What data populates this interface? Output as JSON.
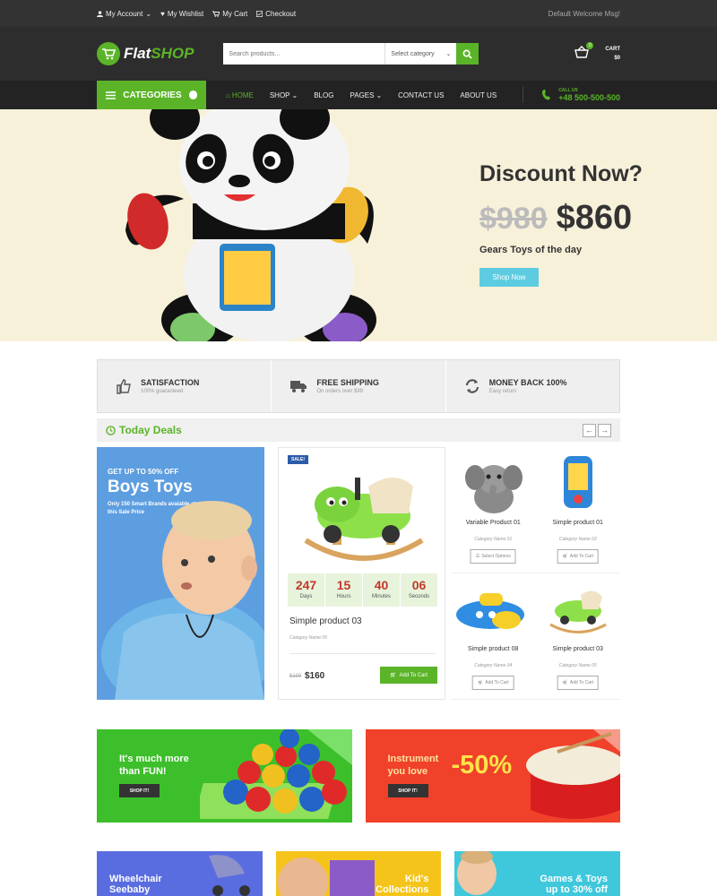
{
  "topbar": {
    "links": [
      {
        "label": "My Account",
        "icon": "user-icon",
        "dropdown": true
      },
      {
        "label": "My Wishlist",
        "icon": "heart-icon"
      },
      {
        "label": "My Cart",
        "icon": "cart-icon"
      },
      {
        "label": "Checkout",
        "icon": "checkout-icon"
      }
    ],
    "welcome": "Default Welcome Msg!"
  },
  "header": {
    "logo_a": "Flat",
    "logo_b": "SHOP",
    "search_placeholder": "Search products...",
    "category_select": "Select category",
    "cart_label": "CART",
    "cart_total": "$0",
    "cart_count": "0"
  },
  "nav": {
    "categories_label": "CATEGORIES",
    "items": [
      {
        "label": "HOME",
        "active": true
      },
      {
        "label": "SHOP",
        "dropdown": true
      },
      {
        "label": "BLOG"
      },
      {
        "label": "PAGES",
        "dropdown": true
      },
      {
        "label": "CONTACT US"
      },
      {
        "label": "ABOUT US"
      }
    ],
    "call_label": "CALL US",
    "call_number": "+48 500-500-500"
  },
  "hero": {
    "title": "Discount Now?",
    "old_price": "$980",
    "new_price": "$860",
    "subtitle": "Gears Toys of the day",
    "button": "Shop Now"
  },
  "features": [
    {
      "title": "SATISFACTION",
      "sub": "100% guaranteed",
      "icon": "thumbs-up-icon"
    },
    {
      "title": "FREE SHIPPING",
      "sub": "On orders over $99",
      "icon": "truck-icon"
    },
    {
      "title": "MONEY BACK 100%",
      "sub": "Easy return",
      "icon": "refresh-icon"
    }
  ],
  "deals": {
    "title": "Today Deals",
    "promo": {
      "line1": "GET UP TO 50% OFF",
      "line2": "Boys Toys",
      "line3": "Only 150 Smart Brands avaiable at this Sale Price"
    },
    "featured": {
      "badge": "SALE!",
      "countdown": [
        {
          "num": "247",
          "unit": "Days"
        },
        {
          "num": "15",
          "unit": "Hours"
        },
        {
          "num": "40",
          "unit": "Minutes"
        },
        {
          "num": "06",
          "unit": "Seconds"
        }
      ],
      "name": "Simple product 03",
      "category": "Category Name 05",
      "old_price": "$199",
      "price": "$160",
      "button": "Add To Cart"
    },
    "products": [
      {
        "name": "Variable Product 01",
        "category": "Category Name 01",
        "button": "Select Options"
      },
      {
        "name": "Simple product 01",
        "category": "Category Name 02",
        "button": "Add To Cart"
      },
      {
        "name": "Simple product 08",
        "category": "Category Name 04",
        "button": "Add To Cart"
      },
      {
        "name": "Simple product 03",
        "category": "Category Name 05",
        "button": "Add To Cart"
      }
    ]
  },
  "banners": [
    {
      "title1": "It's much more",
      "title2": "than FUN!",
      "button": "SHOP IT!",
      "color": "#3cbf2a"
    },
    {
      "title1": "Instrument",
      "title2": "you love",
      "discount": "-50%",
      "button": "SHOP IT!",
      "color": "#f0412a"
    }
  ],
  "bottom_banners": [
    {
      "line1": "Wheelchair",
      "line2": "Seebaby"
    },
    {
      "line1": "Kid's",
      "line2": "Collections"
    },
    {
      "line1": "Games & Toys",
      "line2": "up to 30% off"
    }
  ]
}
